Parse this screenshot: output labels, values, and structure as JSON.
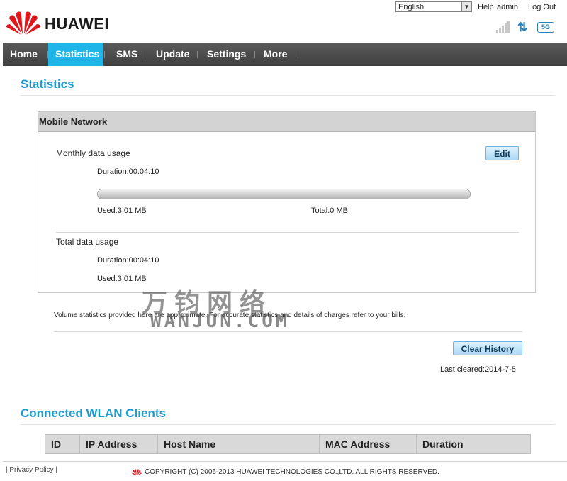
{
  "header": {
    "brand": "HUAWEI",
    "language_selected": "English",
    "help_label": "Help",
    "user_label": "admin",
    "logout_label": "Log Out",
    "network_type": "5G"
  },
  "nav": {
    "items": [
      {
        "label": "Home",
        "active": false
      },
      {
        "label": "Statistics",
        "active": true
      },
      {
        "label": "SMS",
        "active": false
      },
      {
        "label": "Update",
        "active": false
      },
      {
        "label": "Settings",
        "active": false
      },
      {
        "label": "More",
        "active": false
      }
    ]
  },
  "statistics": {
    "title": "Statistics",
    "panel_title": "Mobile Network",
    "monthly": {
      "label": "Monthly data usage",
      "edit_label": "Edit",
      "duration": "Duration:00:04:10",
      "used": "Used:3.01 MB",
      "total": "Total:0 MB",
      "progress_fraction": 1.0
    },
    "total": {
      "label": "Total data usage",
      "duration": "Duration:00:04:10",
      "used": "Used:3.01 MB"
    },
    "note": "Volume statistics provided here are approximate. For accurate statistics and details of charges refer to your bills.",
    "clear_history_label": "Clear History",
    "last_cleared": "Last cleared:2014-7-5"
  },
  "wlan": {
    "title": "Connected WLAN Clients",
    "columns": [
      "ID",
      "IP Address",
      "Host Name",
      "MAC Address",
      "Duration"
    ]
  },
  "footer": {
    "privacy_label": "Privacy Policy",
    "copyright": "COPYRIGHT (C) 2006-2013 HUAWEI TECHNOLOGIES CO.,LTD. ALL RIGHTS RESERVED."
  },
  "watermark": {
    "line1": "万钧网络",
    "line2": "WANJUN.COM"
  },
  "colors": {
    "accent": "#1fb5e8",
    "nav_bg": "#4a4a4a",
    "title": "#1f9dd0",
    "logo_red": "#e0161c"
  }
}
